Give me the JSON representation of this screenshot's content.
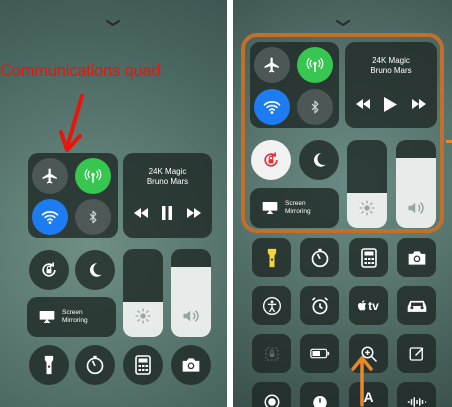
{
  "annotation": {
    "label": "Communications quad",
    "color": "#e8160a",
    "highlight_color": "#c26f2a"
  },
  "left_panel": {
    "now_playing": {
      "title": "24K Magic",
      "artist": "Bruno Mars"
    },
    "screen_mirroring": {
      "line1": "Screen",
      "line2": "Mirroring"
    },
    "brightness_level": 0.4,
    "volume_level": 0.8
  },
  "right_panel": {
    "now_playing": {
      "title": "24K Magic",
      "artist": "Bruno Mars"
    },
    "screen_mirroring": {
      "line1": "Screen",
      "line2": "Mirroring"
    },
    "brightness_level": 0.4,
    "volume_level": 0.8,
    "apple_tv_label": "tv",
    "bottom_partial_label": "A"
  },
  "icons": {
    "airplane": "airplane-icon",
    "cellular": "cellular-icon",
    "wifi": "wifi-icon",
    "bluetooth": "bluetooth-icon",
    "rotation_lock": "rotation-lock-icon",
    "do_not_disturb": "moon-icon",
    "flashlight": "flashlight-icon",
    "timer": "timer-icon",
    "calculator": "calculator-icon",
    "camera": "camera-icon",
    "accessibility": "accessibility-icon",
    "alarm": "alarm-icon",
    "apple_tv": "apple-tv-icon",
    "car": "car-icon",
    "guided_access": "lock-icon",
    "low_power": "battery-icon",
    "magnifier": "magnifier-icon",
    "notes": "notes-icon"
  }
}
